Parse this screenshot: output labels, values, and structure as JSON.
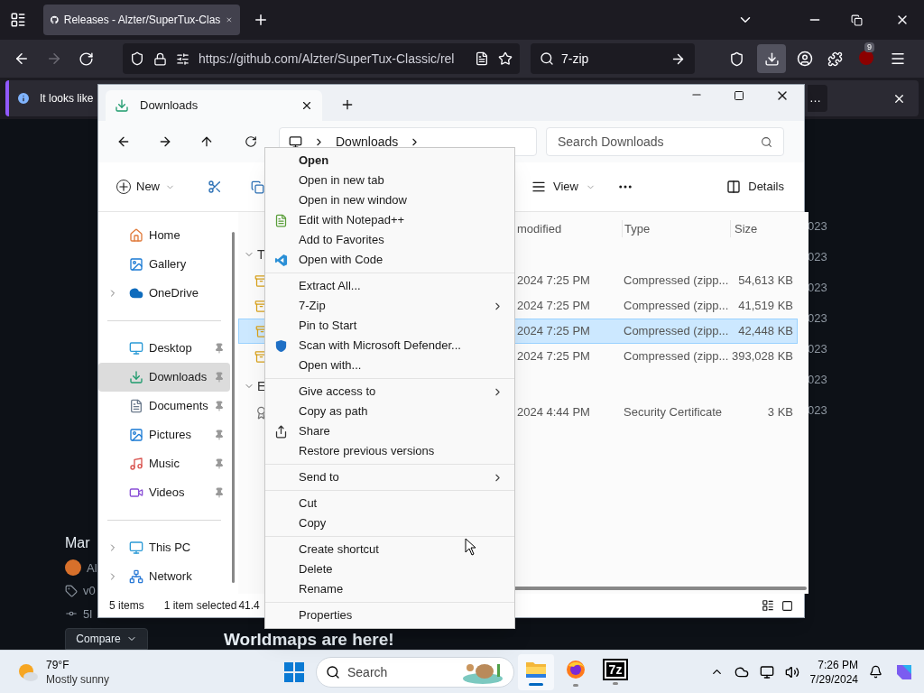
{
  "browser": {
    "tab_title": "Releases - Alzter/SuperTux-Clas",
    "url": "https://github.com/Alzter/SuperTux-Classic/rel",
    "search_value": "7-zip",
    "badge": "9"
  },
  "notification": {
    "text": "It looks like",
    "button": "…"
  },
  "page": {
    "date": "Mar",
    "author": "Al",
    "tag": "v0",
    "commit": "5l",
    "compare_button": "Compare",
    "heading": "Worldmaps are here!",
    "side_dates": [
      "023",
      "023",
      "023",
      "023",
      "023",
      "023",
      "023"
    ]
  },
  "explorer": {
    "tab": "Downloads",
    "breadcrumb": "Downloads",
    "search_placeholder": "Search Downloads",
    "new_button": "New",
    "view_button": "View",
    "details_button": "Details",
    "sidebar": [
      [
        {
          "label": "Home",
          "kind": "home",
          "pinned": false,
          "expandable": false,
          "selected": false
        },
        {
          "label": "Gallery",
          "kind": "gallery",
          "pinned": false,
          "expandable": false,
          "selected": false
        },
        {
          "label": "OneDrive",
          "kind": "cloud",
          "pinned": false,
          "expandable": true,
          "selected": false
        }
      ],
      [
        {
          "label": "Desktop",
          "kind": "desktop",
          "pinned": true,
          "expandable": false,
          "selected": false
        },
        {
          "label": "Downloads",
          "kind": "downloads",
          "pinned": true,
          "expandable": false,
          "selected": true
        },
        {
          "label": "Documents",
          "kind": "documents",
          "pinned": true,
          "expandable": false,
          "selected": false
        },
        {
          "label": "Pictures",
          "kind": "pictures",
          "pinned": true,
          "expandable": false,
          "selected": false
        },
        {
          "label": "Music",
          "kind": "music",
          "pinned": true,
          "expandable": false,
          "selected": false
        },
        {
          "label": "Videos",
          "kind": "videos",
          "pinned": true,
          "expandable": false,
          "selected": false
        }
      ],
      [
        {
          "label": "This PC",
          "kind": "pc",
          "pinned": false,
          "expandable": true,
          "selected": false
        },
        {
          "label": "Network",
          "kind": "network",
          "pinned": false,
          "expandable": true,
          "selected": false
        }
      ]
    ],
    "columns": [
      "modified",
      "Type",
      "Size"
    ],
    "groups": [
      {
        "label": "T",
        "expanded": true,
        "rows": [
          {
            "kind": "zip",
            "modified": "2024 7:25 PM",
            "type": "Compressed (zipp...",
            "size": "54,613 KB",
            "selected": false
          },
          {
            "kind": "zip",
            "modified": "2024 7:25 PM",
            "type": "Compressed (zipp...",
            "size": "41,519 KB",
            "selected": false
          },
          {
            "kind": "zip",
            "modified": "2024 7:25 PM",
            "type": "Compressed (zipp...",
            "size": "42,448 KB",
            "selected": true
          },
          {
            "kind": "zip",
            "modified": "2024 7:25 PM",
            "type": "Compressed (zipp...",
            "size": "393,028 KB",
            "selected": false
          }
        ]
      },
      {
        "label": "E",
        "expanded": true,
        "rows": [
          {
            "kind": "certificate",
            "modified": "2024 4:44 PM",
            "type": "Security Certificate",
            "size": "3 KB",
            "selected": false
          }
        ]
      }
    ],
    "status": [
      "5 items",
      "1 item selected",
      "41.4"
    ]
  },
  "context_menu": [
    [
      {
        "label": "Open",
        "default": true,
        "submenu": false
      },
      {
        "label": "Open in new tab",
        "default": false,
        "submenu": false
      },
      {
        "label": "Open in new window",
        "default": false,
        "submenu": false
      },
      {
        "label": "Edit with Notepad++",
        "kind": "notepad",
        "default": false,
        "submenu": false
      },
      {
        "label": "Add to Favorites",
        "default": false,
        "submenu": false
      },
      {
        "label": "Open with Code",
        "kind": "code",
        "default": false,
        "submenu": false
      }
    ],
    [
      {
        "label": "Extract All...",
        "default": false,
        "submenu": false
      },
      {
        "label": "7-Zip",
        "default": false,
        "submenu": true
      },
      {
        "label": "Pin to Start",
        "default": false,
        "submenu": false
      },
      {
        "label": "Scan with Microsoft Defender...",
        "kind": "shield",
        "default": false,
        "submenu": false
      },
      {
        "label": "Open with...",
        "default": false,
        "submenu": false
      }
    ],
    [
      {
        "label": "Give access to",
        "default": false,
        "submenu": true
      },
      {
        "label": "Copy as path",
        "default": false,
        "submenu": false
      },
      {
        "label": "Share",
        "kind": "share",
        "default": false,
        "submenu": false
      },
      {
        "label": "Restore previous versions",
        "default": false,
        "submenu": false
      }
    ],
    [
      {
        "label": "Send to",
        "default": false,
        "submenu": true
      }
    ],
    [
      {
        "label": "Cut",
        "default": false,
        "submenu": false
      },
      {
        "label": "Copy",
        "default": false,
        "submenu": false
      }
    ],
    [
      {
        "label": "Create shortcut",
        "default": false,
        "submenu": false
      },
      {
        "label": "Delete",
        "default": false,
        "submenu": false
      },
      {
        "label": "Rename",
        "default": false,
        "submenu": false
      }
    ],
    [
      {
        "label": "Properties",
        "default": false,
        "submenu": false
      }
    ]
  ],
  "taskbar": {
    "temperature": "79°F",
    "weather": "Mostly sunny",
    "search": "Search",
    "apps": [
      {
        "kind": "explorer",
        "selected": true
      },
      {
        "kind": "firefox",
        "selected": false
      },
      {
        "kind": "sevenzip",
        "label": "7z",
        "selected": false
      }
    ],
    "time": "7:26 PM",
    "date": "7/29/2024"
  }
}
